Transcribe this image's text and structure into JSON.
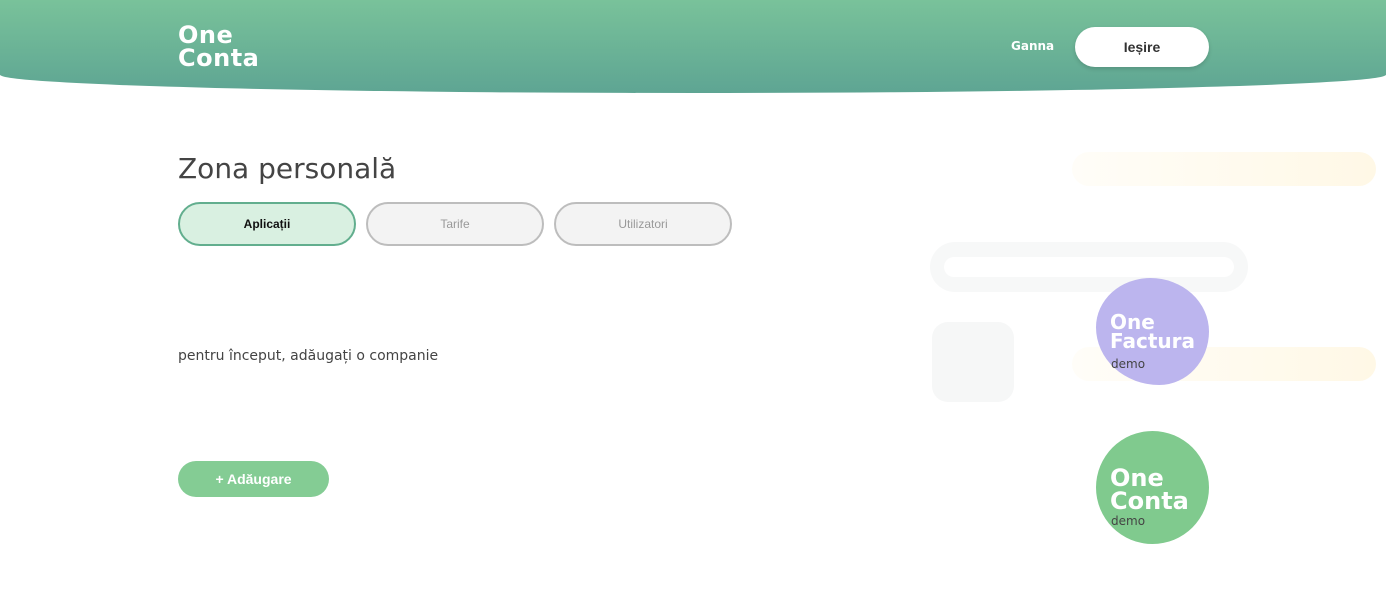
{
  "header": {
    "logo_line1": "One",
    "logo_line2": "Conta",
    "user_name": "Ganna",
    "logout_label": "Ieșire"
  },
  "main": {
    "title": "Zona personală",
    "tabs": [
      {
        "label": "Aplicații",
        "active": true
      },
      {
        "label": "Tarife",
        "active": false
      },
      {
        "label": "Utilizatori",
        "active": false
      }
    ],
    "hint": "pentru început, adăugați o companie",
    "add_label": "+ Adăugare"
  },
  "apps": [
    {
      "line1": "One",
      "line2": "Factura",
      "tag": "demo",
      "color": "#bcb5ee"
    },
    {
      "line1": "One",
      "line2": "Conta",
      "tag": "demo",
      "color": "#80ca8e"
    }
  ],
  "colors": {
    "header_gradient": [
      "#79c29a",
      "#5ea593"
    ],
    "active_tab_bg": "#d9f0e1",
    "add_button": "#84cc94"
  }
}
